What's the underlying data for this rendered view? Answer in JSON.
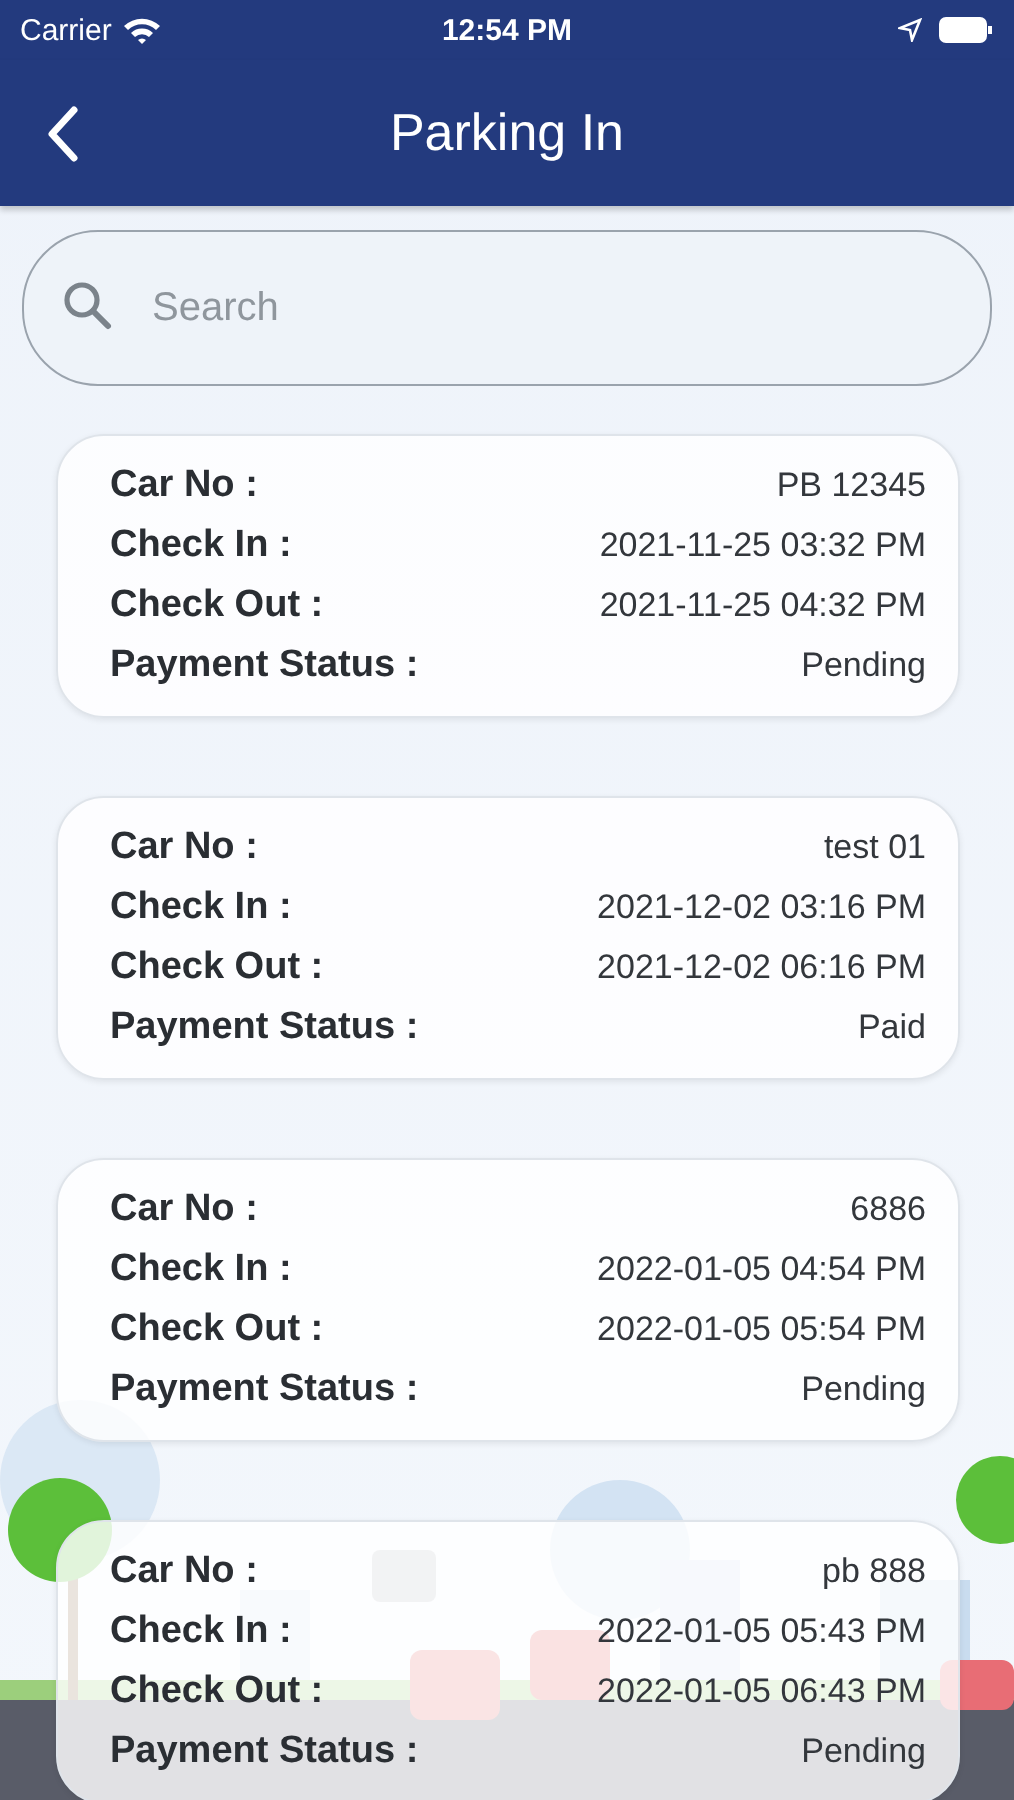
{
  "status_bar": {
    "carrier": "Carrier",
    "time": "12:54 PM"
  },
  "header": {
    "title": "Parking In"
  },
  "search": {
    "placeholder": "Search"
  },
  "records": [
    {
      "rows": [
        {
          "label": "Car No :",
          "value": "PB 12345"
        },
        {
          "label": "Check In :",
          "value": "2021-11-25 03:32 PM"
        },
        {
          "label": "Check Out :",
          "value": "2021-11-25 04:32 PM"
        },
        {
          "label": "Payment Status :",
          "value": "Pending"
        }
      ]
    },
    {
      "rows": [
        {
          "label": "Car No :",
          "value": "test 01"
        },
        {
          "label": "Check In :",
          "value": "2021-12-02 03:16 PM"
        },
        {
          "label": "Check Out :",
          "value": "2021-12-02 06:16 PM"
        },
        {
          "label": "Payment Status :",
          "value": "Paid"
        }
      ]
    },
    {
      "rows": [
        {
          "label": "Car No :",
          "value": "6886"
        },
        {
          "label": "Check In :",
          "value": "2022-01-05 04:54 PM"
        },
        {
          "label": "Check Out :",
          "value": "2022-01-05 05:54 PM"
        },
        {
          "label": "Payment Status :",
          "value": "Pending"
        }
      ]
    },
    {
      "rows": [
        {
          "label": "Car No :",
          "value": "pb 888"
        },
        {
          "label": "Check In :",
          "value": "2022-01-05 05:43 PM"
        },
        {
          "label": "Check Out :",
          "value": "2022-01-05 06:43 PM"
        },
        {
          "label": "Payment Status :",
          "value": "Pending"
        }
      ]
    }
  ]
}
